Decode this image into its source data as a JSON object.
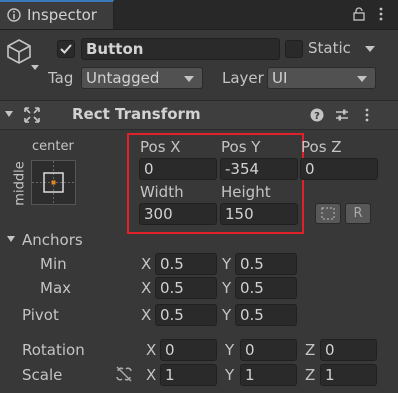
{
  "window": {
    "tab_title": "Inspector"
  },
  "gameobject": {
    "name": "Button",
    "static_label": "Static",
    "tag_label": "Tag",
    "tag_value": "Untagged",
    "layer_label": "Layer",
    "layer_value": "UI"
  },
  "component": {
    "title": "Rect Transform"
  },
  "anchor_preset": {
    "horizontal": "center",
    "vertical": "middle"
  },
  "pos": {
    "x_label": "Pos X",
    "x_value": "0",
    "y_label": "Pos Y",
    "y_value": "-354",
    "z_label": "Pos Z",
    "z_value": "0"
  },
  "size": {
    "width_label": "Width",
    "width_value": "300",
    "height_label": "Height",
    "height_value": "150"
  },
  "raw_button_label": "R",
  "anchors": {
    "label": "Anchors",
    "min_label": "Min",
    "min_x": "0.5",
    "min_y": "0.5",
    "max_label": "Max",
    "max_x": "0.5",
    "max_y": "0.5"
  },
  "pivot": {
    "label": "Pivot",
    "x": "0.5",
    "y": "0.5"
  },
  "rotation": {
    "label": "Rotation",
    "x": "0",
    "y": "0",
    "z": "0"
  },
  "scale": {
    "label": "Scale",
    "x": "1",
    "y": "1",
    "z": "1"
  },
  "axis": {
    "x": "X",
    "y": "Y",
    "z": "Z"
  }
}
